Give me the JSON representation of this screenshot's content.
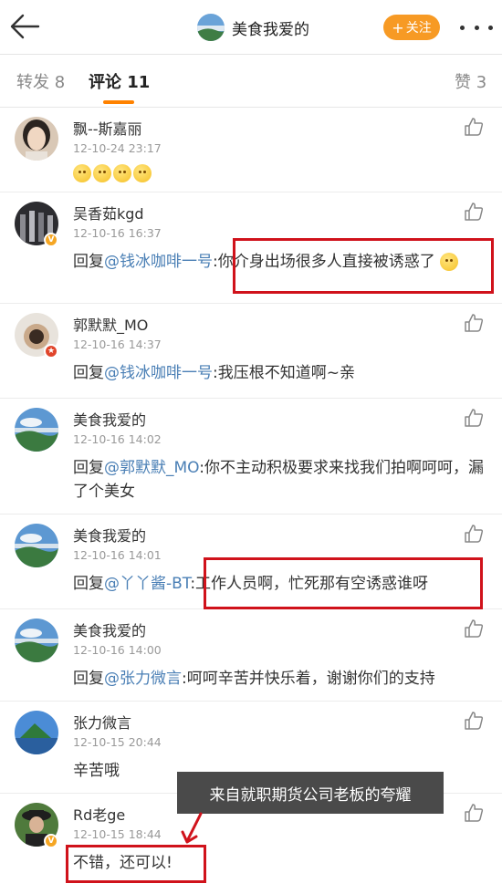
{
  "header": {
    "title": "美食我爱的",
    "follow_label": "关注"
  },
  "tabs": {
    "repost": "转发 8",
    "comment": "评论 11",
    "like": "赞 3"
  },
  "colors": {
    "accent": "#ff8200",
    "follow_bg": "#f79a24",
    "mention": "#4a7fb5",
    "highlight": "#d0121b"
  },
  "comments": [
    {
      "user": "飘--斯嘉丽",
      "time": "12-10-24 23:17",
      "text": "",
      "emoji": [
        "grin-emoji",
        "grin-emoji",
        "smile-emoji",
        "smile-emoji"
      ]
    },
    {
      "user": "吴香茹kgd",
      "time": "12-10-16 16:37",
      "prefix": "回复",
      "mention": "@钱冰咖啡一号",
      "text": ":你介身出场很多人直接被诱惑了"
    },
    {
      "user": "郭默默_MO",
      "time": "12-10-16 14:37",
      "prefix": "回复",
      "mention": "@钱冰咖啡一号",
      "text": ":我压根不知道啊~亲"
    },
    {
      "user": "美食我爱的",
      "time": "12-10-16 14:02",
      "prefix": "回复",
      "mention": "@郭默默_MO",
      "text": ":你不主动积极要求来找我们拍啊呵呵，漏了个美女"
    },
    {
      "user": "美食我爱的",
      "time": "12-10-16 14:01",
      "prefix": "回复",
      "mention": "@丫丫酱-BT",
      "text": ":工作人员啊，忙死那有空诱惑谁呀"
    },
    {
      "user": "美食我爱的",
      "time": "12-10-16 14:00",
      "prefix": "回复",
      "mention": "@张力微言",
      "text": ":呵呵辛苦并快乐着，谢谢你们的支持"
    },
    {
      "user": "张力微言",
      "time": "12-10-15 20:44",
      "text": "辛苦哦"
    },
    {
      "user": "Rd老ge",
      "time": "12-10-15 18:44",
      "text": "不错，还可以!"
    }
  ],
  "annotation": {
    "tooltip": "来自就职期货公司老板的夸耀"
  }
}
